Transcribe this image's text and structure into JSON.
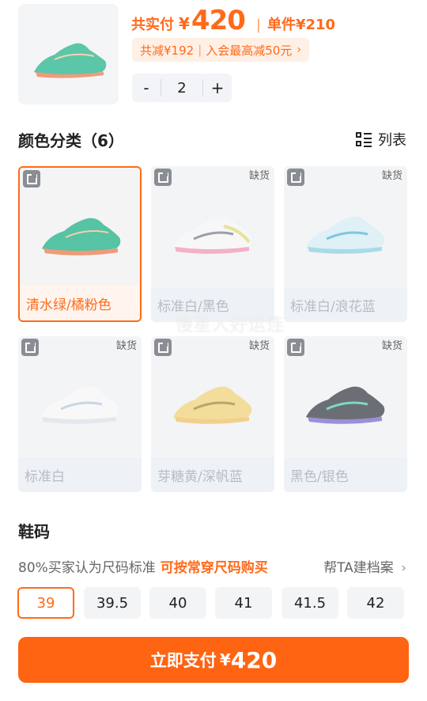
{
  "header": {
    "total_label": "共实付",
    "currency": "¥",
    "total_price": "420",
    "unit_label": "单件¥210",
    "discount": {
      "saved": "共减¥192",
      "member": "入会最高减50元",
      "chevron": "›"
    },
    "stepper": {
      "minus": "-",
      "quantity": "2",
      "plus": "+"
    }
  },
  "color_section": {
    "title": "颜色分类（6）",
    "list_toggle": "列表",
    "out_of_stock_label": "缺货",
    "variants": [
      {
        "name": "清水绿/橘粉色",
        "selected": true,
        "out_of_stock": false
      },
      {
        "name": "标准白/黑色",
        "selected": false,
        "out_of_stock": true
      },
      {
        "name": "标准白/浪花蓝",
        "selected": false,
        "out_of_stock": true
      },
      {
        "name": "标准白",
        "selected": false,
        "out_of_stock": true
      },
      {
        "name": "芽糖黄/深帆蓝",
        "selected": false,
        "out_of_stock": true
      },
      {
        "name": "黑色/银色",
        "selected": false,
        "out_of_stock": true
      }
    ],
    "watermark": "慢星人好运连"
  },
  "size_section": {
    "title": "鞋码",
    "tip": "80%买家认为尺码标准",
    "tip_highlight": "可按常穿尺码购买",
    "file_link": "帮TA建档案",
    "file_chevron": "›",
    "sizes": [
      "39",
      "39.5",
      "40",
      "41",
      "41.5",
      "42"
    ],
    "selected_size": "39"
  },
  "pay_button": {
    "label": "立即支付",
    "currency": "¥",
    "amount": "420"
  },
  "colors": {
    "accent": "#ff6a1a",
    "pay_button": "#ff6412",
    "disabled_text": "#b8bcc4"
  }
}
